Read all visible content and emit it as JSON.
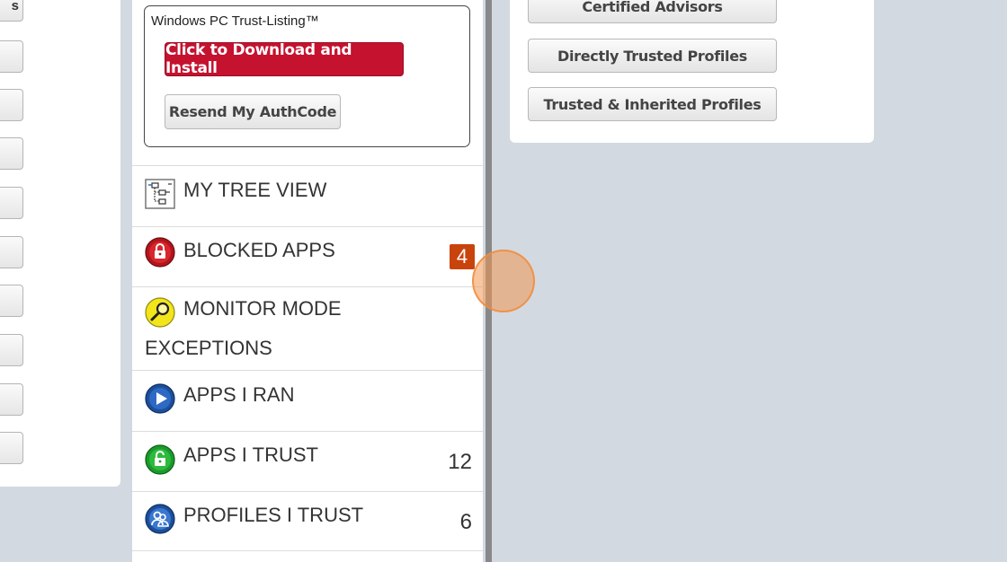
{
  "left_panel": {
    "buttons": [
      {
        "label": "s"
      },
      {
        "label": ""
      },
      {
        "label": ""
      },
      {
        "label": ""
      },
      {
        "label": ""
      },
      {
        "label": ""
      },
      {
        "label": ""
      },
      {
        "label": ""
      },
      {
        "label": ""
      },
      {
        "label": ""
      }
    ]
  },
  "install_box": {
    "title": "Windows PC Trust-Listing™",
    "download_label": "Click to Download and Install",
    "resend_label": "Resend My AuthCode"
  },
  "menu": {
    "items": [
      {
        "label": "MY TREE VIEW",
        "icon": "tree-view-icon",
        "count": ""
      },
      {
        "label": "BLOCKED APPS",
        "icon": "blocked-lock-icon",
        "count": "4"
      },
      {
        "label": "MONITOR MODE EXCEPTIONS",
        "icon": "magnifier-icon",
        "count": ""
      },
      {
        "label": "APPS I RAN",
        "icon": "play-icon",
        "count": ""
      },
      {
        "label": "APPS I TRUST",
        "icon": "trusted-lock-icon",
        "count": "12"
      },
      {
        "label": "PROFILES I TRUST",
        "icon": "profiles-icon",
        "count": "6"
      }
    ]
  },
  "right_panel": {
    "buttons": [
      {
        "label": "Certified Advisors"
      },
      {
        "label": "Directly Trusted Profiles"
      },
      {
        "label": "Trusted & Inherited Profiles"
      }
    ]
  },
  "colors": {
    "background": "#d3d9e0",
    "download_button": "#c4122f",
    "badge": "#c9430c",
    "divider": "#888888"
  }
}
